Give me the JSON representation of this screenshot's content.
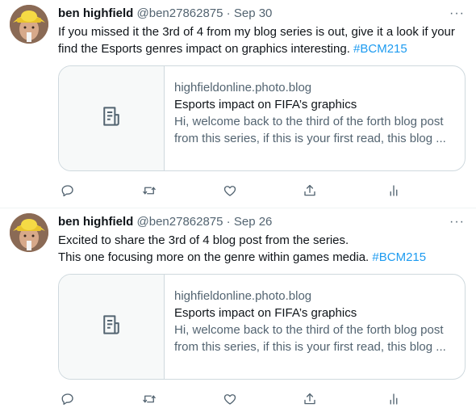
{
  "tweets": [
    {
      "name": "ben highfield",
      "handle": "@ben27862875",
      "sep": "·",
      "date": "Sep 30",
      "more": "···",
      "lines": [
        {
          "text": "If you missed it the 3rd of 4 from my blog series is out, give it a look if your",
          "tag": ""
        },
        {
          "text": "find the Esports genres impact on graphics interesting. ",
          "tag": "#BCM215"
        }
      ],
      "card": {
        "domain": "highfieldonline.photo.blog",
        "title": "Esports impact on FIFA’s graphics",
        "desc1": "Hi, welcome back to the third of the forth blog post",
        "desc2": "from this series, if this is your first read, this blog ..."
      },
      "actions": {
        "reply_icon": "reply-icon",
        "retweet_icon": "retweet-icon",
        "like_icon": "heart-icon",
        "share_icon": "share-icon",
        "analytics_icon": "analytics-icon"
      }
    },
    {
      "name": "ben highfield",
      "handle": "@ben27862875",
      "sep": "·",
      "date": "Sep 26",
      "more": "···",
      "lines": [
        {
          "text": "Excited to share the 3rd of 4 blog post from the series.",
          "tag": ""
        },
        {
          "text": "This one focusing more on the genre within games media. ",
          "tag": "#BCM215"
        }
      ],
      "card": {
        "domain": "highfieldonline.photo.blog",
        "title": "Esports impact on FIFA’s graphics",
        "desc1": "Hi, welcome back to the third of the forth blog post",
        "desc2": "from this series, if this is your first read, this blog ..."
      },
      "actions": {
        "reply_icon": "reply-icon",
        "retweet_icon": "retweet-icon",
        "like_icon": "heart-icon",
        "share_icon": "share-icon",
        "analytics_icon": "analytics-icon"
      }
    }
  ],
  "colors": {
    "link": "#1d9bf0",
    "secondary_text": "#536471",
    "primary_text": "#0f1419",
    "border": "#cfd9de"
  }
}
